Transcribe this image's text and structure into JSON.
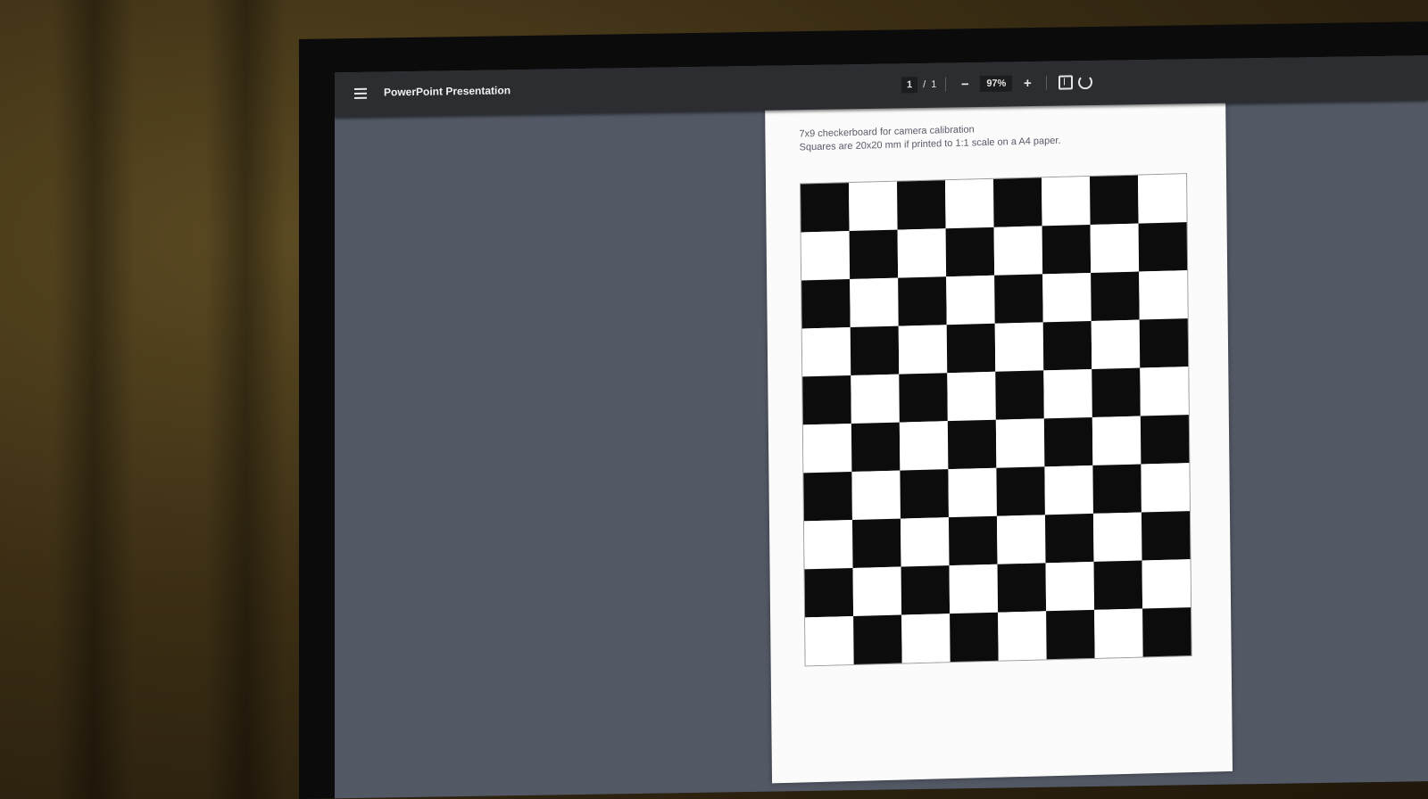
{
  "toolbar": {
    "menu_icon": "hamburger-menu-icon",
    "title": "PowerPoint Presentation",
    "page_current": "1",
    "page_separator": "/",
    "page_total": "1",
    "zoom_out_symbol": "−",
    "zoom_level": "97%",
    "zoom_in_symbol": "+",
    "fit_icon": "fit-to-page-icon",
    "rotate_icon": "rotate-icon"
  },
  "document": {
    "line1": "7x9 checkerboard for camera calibration",
    "line2": "Squares are 20x20 mm if printed to 1:1 scale on a A4 paper.",
    "checkerboard": {
      "columns": 8,
      "rows": 10,
      "dark_color": "#0c0c0c",
      "light_color": "#ffffff"
    }
  }
}
